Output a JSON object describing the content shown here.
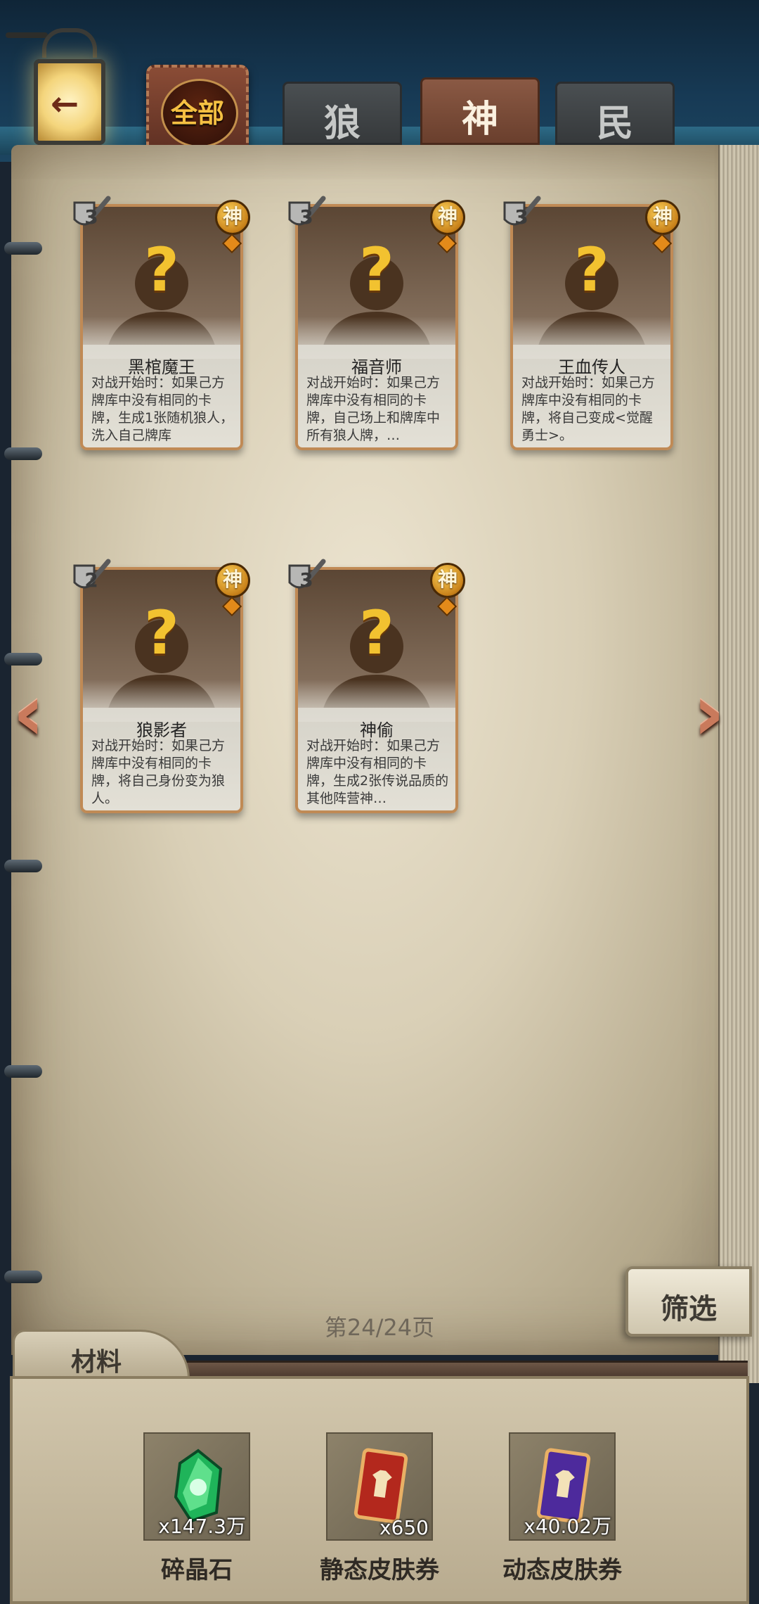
{
  "header": {
    "back_icon": "back-arrow-icon",
    "tabs": [
      {
        "label": "全部",
        "active": false
      },
      {
        "label": "狼",
        "active": false
      },
      {
        "label": "神",
        "active": true
      },
      {
        "label": "民",
        "active": false
      }
    ]
  },
  "cards": [
    {
      "cost": "3",
      "faction": "神",
      "name": "黑棺魔王",
      "desc": "对战开始时：如果己方牌库中没有相同的卡牌，生成1张随机狼人，洗入自己牌库"
    },
    {
      "cost": "3",
      "faction": "神",
      "name": "福音师",
      "desc": "对战开始时：如果己方牌库中没有相同的卡牌，自己场上和牌库中所有狼人牌，…"
    },
    {
      "cost": "3",
      "faction": "神",
      "name": "王血传人",
      "desc": "对战开始时：如果己方牌库中没有相同的卡牌，将自己变成<觉醒勇士>。"
    },
    {
      "cost": "2",
      "faction": "神",
      "name": "狼影者",
      "desc": "对战开始时：如果己方牌库中没有相同的卡牌，将自己身份变为狼人。"
    },
    {
      "cost": "3",
      "faction": "神",
      "name": "神偷",
      "desc": "对战开始时：如果己方牌库中没有相同的卡牌，生成2张传说品质的其他阵营神…"
    }
  ],
  "pagination": {
    "text": "第24/24页",
    "prev_icon": "chevron-left-icon",
    "next_icon": "chevron-right-icon"
  },
  "filter": {
    "label": "筛选"
  },
  "materials": {
    "title": "材料",
    "items": [
      {
        "name": "碎晶石",
        "count": "x147.3万",
        "icon": "green-crystal-icon"
      },
      {
        "name": "静态皮肤券",
        "count": "x650",
        "icon": "red-skin-ticket-icon"
      },
      {
        "name": "动态皮肤券",
        "count": "x40.02万",
        "icon": "purple-skin-ticket-icon"
      }
    ]
  },
  "colors": {
    "accent": "#f5c042",
    "active_tab": "#7a4b36",
    "paper": "#ddd3bb"
  }
}
